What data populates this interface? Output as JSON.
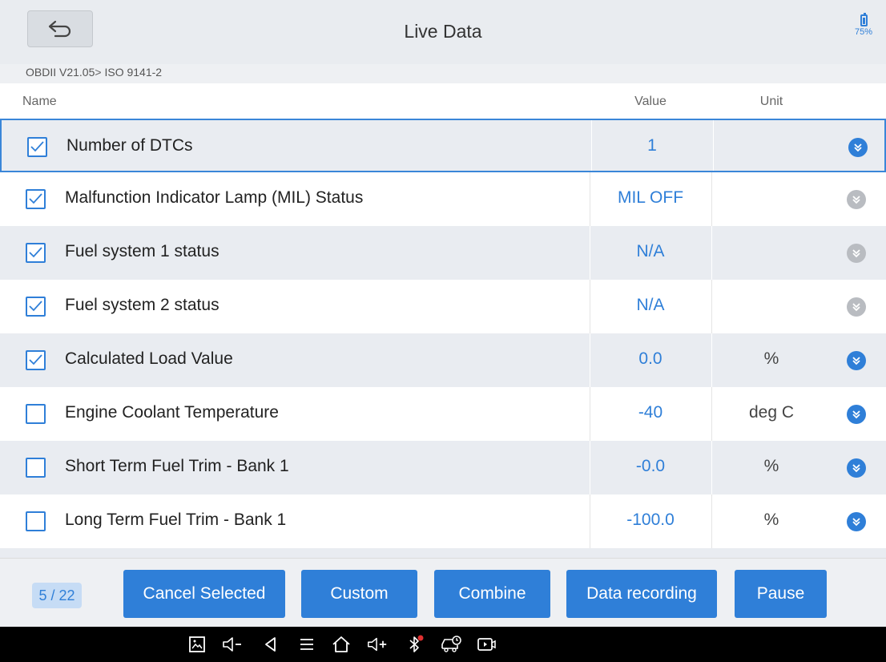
{
  "header": {
    "title": "Live Data",
    "battery_text": "75%",
    "battery_level": 0.75
  },
  "breadcrumb": {
    "part1": "OBDII V21.05",
    "separator": ">",
    "part2": "ISO 9141-2"
  },
  "columns": {
    "name": "Name",
    "value": "Value",
    "unit": "Unit"
  },
  "rows": [
    {
      "checked": true,
      "name": "Number of DTCs",
      "value": "1",
      "unit": "",
      "expand_active": true
    },
    {
      "checked": true,
      "name": "Malfunction Indicator Lamp (MIL) Status",
      "value": "MIL OFF",
      "unit": "",
      "expand_active": false
    },
    {
      "checked": true,
      "name": "Fuel system 1 status",
      "value": "N/A",
      "unit": "",
      "expand_active": false
    },
    {
      "checked": true,
      "name": "Fuel system 2 status",
      "value": "N/A",
      "unit": "",
      "expand_active": false
    },
    {
      "checked": true,
      "name": "Calculated Load Value",
      "value": "0.0",
      "unit": "%",
      "expand_active": true
    },
    {
      "checked": false,
      "name": "Engine Coolant Temperature",
      "value": "-40",
      "unit": "deg C",
      "expand_active": true
    },
    {
      "checked": false,
      "name": "Short Term Fuel Trim - Bank 1",
      "value": "-0.0",
      "unit": "%",
      "expand_active": true
    },
    {
      "checked": false,
      "name": "Long Term Fuel Trim - Bank 1",
      "value": "-100.0",
      "unit": "%",
      "expand_active": true
    }
  ],
  "footer": {
    "counter": "5 / 22",
    "buttons": {
      "cancel_selected": "Cancel Selected",
      "custom": "Custom",
      "combine": "Combine",
      "data_recording": "Data recording",
      "pause": "Pause"
    }
  },
  "navbar": {
    "icons": [
      "screenshot-icon",
      "volume-down-icon",
      "back-icon",
      "menu-icon",
      "home-icon",
      "volume-up-icon",
      "bluetooth-icon",
      "vci-car-icon",
      "screen-record-icon"
    ]
  },
  "colors": {
    "accent": "#2f7fd8",
    "inactive": "#b9bcc1",
    "row_alt": "#e9ecf1"
  }
}
